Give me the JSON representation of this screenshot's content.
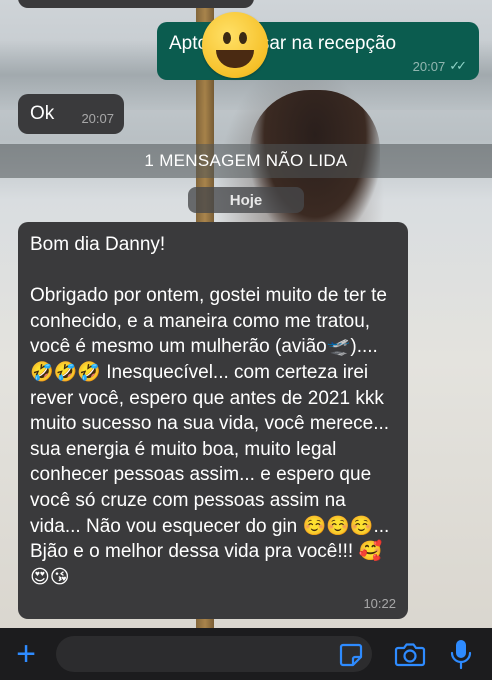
{
  "chat": {
    "messages": [
      {
        "id": "out1",
        "direction": "outgoing",
        "text": "Apto        ó passar na recepção",
        "time": "20:07",
        "status": "read"
      },
      {
        "id": "in1",
        "direction": "incoming",
        "text": "Ok",
        "time": "20:07"
      },
      {
        "id": "in2",
        "direction": "incoming",
        "text": "Bom dia Danny!\n\nObrigado por ontem, gostei muito de ter te conhecido, e a maneira como me tratou, você é mesmo um mulherão (avião🛫).... 🤣🤣🤣 Inesquecível... com certeza irei rever você, espero que antes de 2021 kkk muito sucesso na sua vida, você merece... sua energia é muito boa, muito legal conhecer pessoas assim... e espero que você só cruze com pessoas assim na vida... Não vou esquecer do gin ☺️☺️☺️...  Bjão e o melhor dessa vida pra você!!! 🥰😍😘",
        "time": "10:22"
      }
    ],
    "unread_banner": "1 MENSAGEM NÃO LIDA",
    "date_chip": "Hoje",
    "read_ticks": "✓✓"
  },
  "composer": {
    "placeholder": "",
    "icons": {
      "add": "plus-icon",
      "sticker": "sticker-icon",
      "camera": "camera-icon",
      "mic": "microphone-icon"
    },
    "plus_glyph": "+",
    "accent_color": "#2e8bff"
  },
  "overlay": {
    "emoji": "grinning-face-sticker"
  },
  "colors": {
    "incoming_bubble": "#3a3a3c",
    "outgoing_bubble": "#0b5c4f",
    "composer_bg": "#1c1c1e"
  }
}
